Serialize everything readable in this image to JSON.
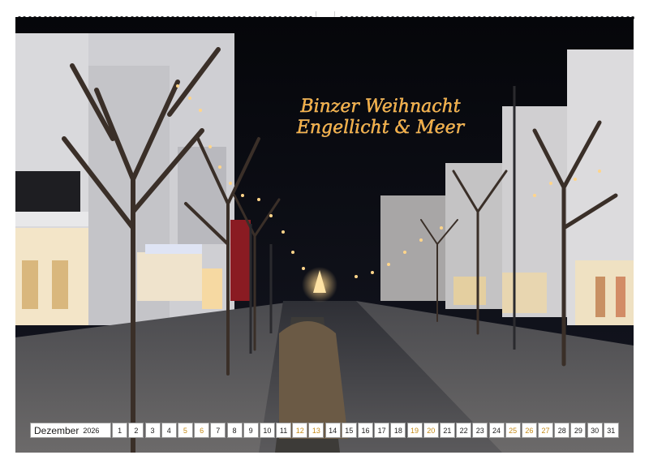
{
  "photo": {
    "sign_line_1": "Binzer Weihnacht",
    "sign_line_2": "Engellicht & Meer",
    "sign_color": "#f2a93b",
    "street_lights_color": "#ffd58a"
  },
  "calendar": {
    "month": "Dezember",
    "year": "2026",
    "weekend_color": "#c48a17",
    "days": [
      {
        "label": "1",
        "weekend": false
      },
      {
        "label": "2",
        "weekend": false
      },
      {
        "label": "3",
        "weekend": false
      },
      {
        "label": "4",
        "weekend": false
      },
      {
        "label": "5",
        "weekend": true
      },
      {
        "label": "6",
        "weekend": true
      },
      {
        "label": "7",
        "weekend": false
      },
      {
        "label": "8",
        "weekend": false
      },
      {
        "label": "9",
        "weekend": false
      },
      {
        "label": "10",
        "weekend": false
      },
      {
        "label": "11",
        "weekend": false
      },
      {
        "label": "12",
        "weekend": true
      },
      {
        "label": "13",
        "weekend": true
      },
      {
        "label": "14",
        "weekend": false
      },
      {
        "label": "15",
        "weekend": false
      },
      {
        "label": "16",
        "weekend": false
      },
      {
        "label": "17",
        "weekend": false
      },
      {
        "label": "18",
        "weekend": false
      },
      {
        "label": "19",
        "weekend": true
      },
      {
        "label": "20",
        "weekend": true
      },
      {
        "label": "21",
        "weekend": false
      },
      {
        "label": "22",
        "weekend": false
      },
      {
        "label": "23",
        "weekend": false
      },
      {
        "label": "24",
        "weekend": false
      },
      {
        "label": "25",
        "weekend": true
      },
      {
        "label": "26",
        "weekend": true
      },
      {
        "label": "27",
        "weekend": true
      },
      {
        "label": "28",
        "weekend": false
      },
      {
        "label": "29",
        "weekend": false
      },
      {
        "label": "30",
        "weekend": false
      },
      {
        "label": "31",
        "weekend": false
      }
    ]
  }
}
